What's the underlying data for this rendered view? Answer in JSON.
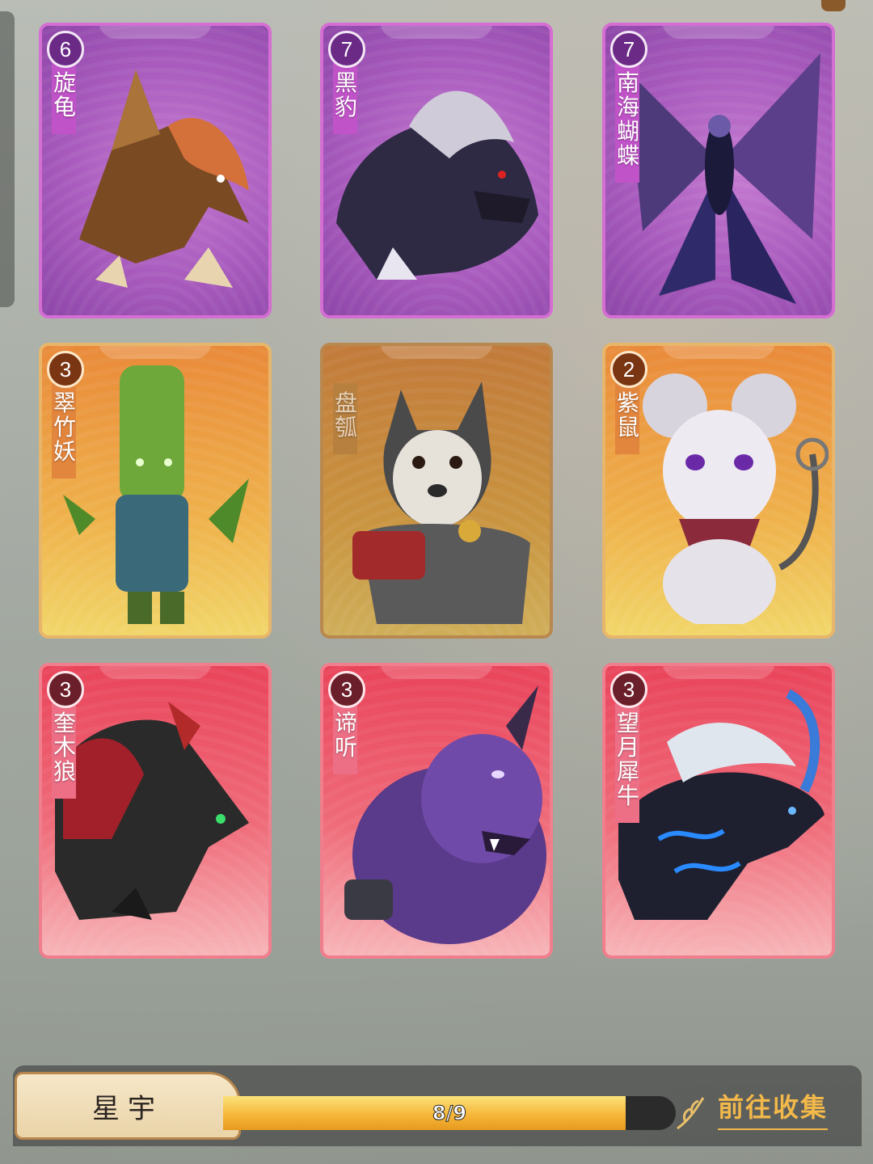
{
  "cards": [
    {
      "name": "旋龟",
      "count": "6",
      "rarity": "purple",
      "icon": "beast-bird-icon"
    },
    {
      "name": "黑豹",
      "count": "7",
      "rarity": "purple",
      "icon": "beast-panther-icon"
    },
    {
      "name": "南海蝴蝶",
      "count": "7",
      "rarity": "purple",
      "icon": "beast-butterfly-icon"
    },
    {
      "name": "翠竹妖",
      "count": "3",
      "rarity": "gold",
      "icon": "beast-bamboo-icon"
    },
    {
      "name": "盘瓠",
      "count": "",
      "rarity": "gold-dim",
      "icon": "beast-dog-icon"
    },
    {
      "name": "紫鼠",
      "count": "2",
      "rarity": "gold",
      "icon": "beast-mouse-icon"
    },
    {
      "name": "奎木狼",
      "count": "3",
      "rarity": "red",
      "icon": "beast-wolf-icon"
    },
    {
      "name": "谛听",
      "count": "3",
      "rarity": "red",
      "icon": "beast-lion-icon"
    },
    {
      "name": "望月犀牛",
      "count": "3",
      "rarity": "red",
      "icon": "beast-rhino-icon"
    }
  ],
  "collection": {
    "name": "星宇",
    "progress_text": "8/9",
    "progress_fraction": 0.889,
    "goto_label": "前往收集"
  }
}
